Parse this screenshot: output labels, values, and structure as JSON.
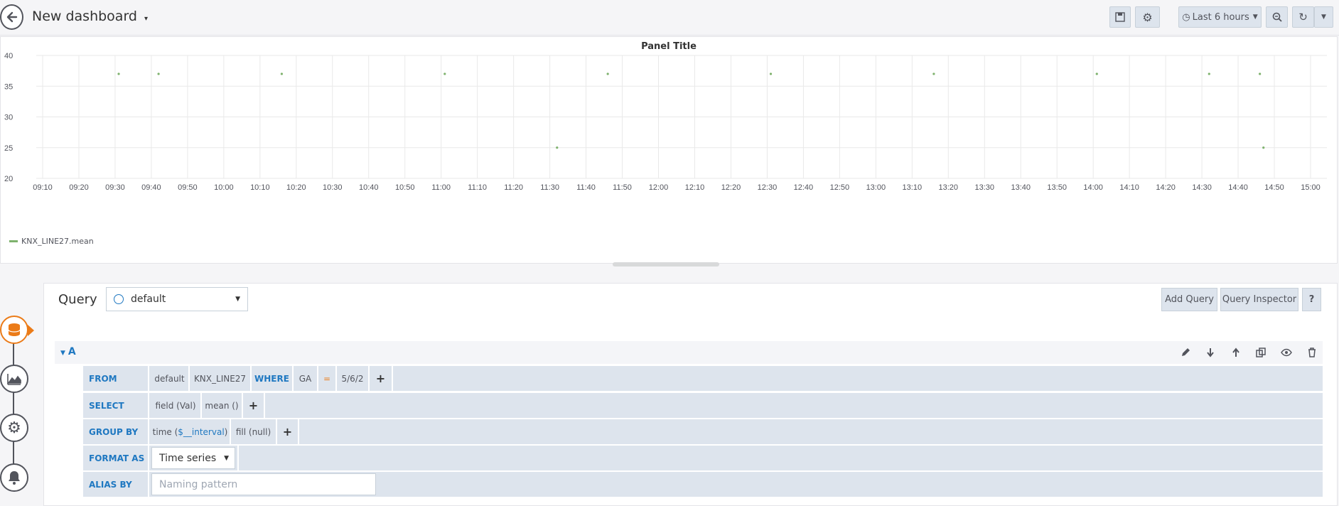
{
  "header": {
    "dashboard_title": "New dashboard",
    "time_range_label": "Last 6 hours"
  },
  "panel": {
    "title": "Panel Title",
    "legend_label": "KNX_LINE27.mean"
  },
  "chart_data": {
    "type": "scatter",
    "title": "Panel Title",
    "ylim": [
      20,
      40
    ],
    "y_ticks": [
      "40",
      "35",
      "30",
      "25",
      "20"
    ],
    "x_ticks": [
      "09:10",
      "09:20",
      "09:30",
      "09:40",
      "09:50",
      "10:00",
      "10:10",
      "10:20",
      "10:30",
      "10:40",
      "10:50",
      "11:00",
      "11:10",
      "11:20",
      "11:30",
      "11:40",
      "11:50",
      "12:00",
      "12:10",
      "12:20",
      "12:30",
      "12:40",
      "12:50",
      "13:00",
      "13:10",
      "13:20",
      "13:30",
      "13:40",
      "13:50",
      "14:00",
      "14:10",
      "14:20",
      "14:30",
      "14:40",
      "14:50",
      "15:00"
    ],
    "series": [
      {
        "name": "KNX_LINE27.mean",
        "color": "#7eb26d",
        "points": [
          {
            "x": "09:31",
            "y": 37
          },
          {
            "x": "09:42",
            "y": 37
          },
          {
            "x": "10:16",
            "y": 37
          },
          {
            "x": "11:01",
            "y": 37
          },
          {
            "x": "11:32",
            "y": 25
          },
          {
            "x": "11:46",
            "y": 37
          },
          {
            "x": "12:31",
            "y": 37
          },
          {
            "x": "13:16",
            "y": 37
          },
          {
            "x": "14:01",
            "y": 37
          },
          {
            "x": "14:32",
            "y": 37
          },
          {
            "x": "14:46",
            "y": 37
          },
          {
            "x": "14:47",
            "y": 25
          }
        ]
      }
    ],
    "grid": true,
    "legend": "bottom-left"
  },
  "editor": {
    "query_label": "Query",
    "datasource": "default",
    "add_query": "Add Query",
    "query_inspector": "Query Inspector",
    "help": "?",
    "query_letter": "A",
    "rows": {
      "from": {
        "label": "FROM",
        "policy": "default",
        "measurement": "KNX_LINE27",
        "where_kw": "WHERE",
        "tag": "GA",
        "op": "=",
        "value": "5/6/2"
      },
      "select": {
        "label": "SELECT",
        "field": "field (Val)",
        "fn": "mean ()"
      },
      "group_by": {
        "label": "GROUP BY",
        "time_prefix": "time (",
        "interval": "$__interval",
        "time_suffix": ")",
        "fill": "fill (null)"
      },
      "format_as": {
        "label": "FORMAT AS",
        "value": "Time series"
      },
      "alias_by": {
        "label": "ALIAS BY",
        "placeholder": "Naming pattern"
      }
    },
    "plus": "+"
  }
}
